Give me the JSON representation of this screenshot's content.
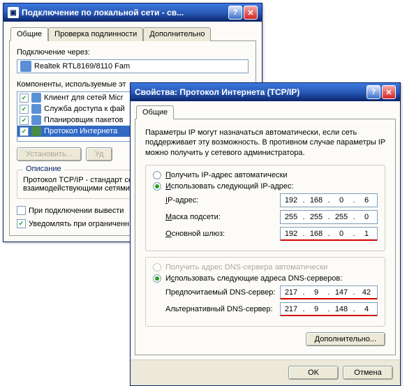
{
  "win1": {
    "title": "Подключение по локальной сети - св...",
    "tabs": [
      "Общие",
      "Проверка подлинности",
      "Дополнительно"
    ],
    "connect_via_label": "Подключение через:",
    "adapter": "Realtek RTL8169/8110 Fam",
    "components_label": "Компоненты, используемые эт",
    "components": [
      {
        "checked": true,
        "label": "Клиент для сетей Micr"
      },
      {
        "checked": true,
        "label": "Служба доступа к фай"
      },
      {
        "checked": true,
        "label": "Планировщик пакетов"
      },
      {
        "checked": true,
        "label": "Протокол Интернета "
      }
    ],
    "buttons": {
      "install": "Установить...",
      "remove": "Уд"
    },
    "desc_group_label": "Описание",
    "desc_text": "Протокол TCP/IP - стандарт сетей, обеспечивающий связ взаимодействующими сетями",
    "check1": "При подключении вывести",
    "check2": "Уведомлять при ограниченн подключении"
  },
  "win2": {
    "title": "Свойства: Протокол Интернета (TCP/IP)",
    "tab": "Общие",
    "info": "Параметры IP могут назначаться автоматически, если сеть поддерживает эту возможность. В противном случае параметры IP можно получить у сетевого администратора.",
    "radio_auto_ip": "Получить IP-адрес автоматически",
    "radio_manual_ip": "Использовать следующий IP-адрес:",
    "ip_label": "IP-адрес:",
    "ip_value": [
      "192",
      "168",
      "0",
      "6"
    ],
    "mask_label": "Маска подсети:",
    "mask_value": [
      "255",
      "255",
      "255",
      "0"
    ],
    "gateway_label": "Основной шлюз:",
    "gateway_value": [
      "192",
      "168",
      "0",
      "1"
    ],
    "radio_auto_dns": "Получить адрес DNS-сервера автоматически",
    "radio_manual_dns": "Использовать следующие адреса DNS-серверов:",
    "dns1_label": "Предпочитаемый DNS-сервер:",
    "dns1_value": [
      "217",
      "9",
      "147",
      "42"
    ],
    "dns2_label": "Альтернативный DNS-сервер:",
    "dns2_value": [
      "217",
      "9",
      "148",
      "4"
    ],
    "advanced_btn": "Дополнительно...",
    "ok_btn": "OK",
    "cancel_btn": "Отмена"
  }
}
